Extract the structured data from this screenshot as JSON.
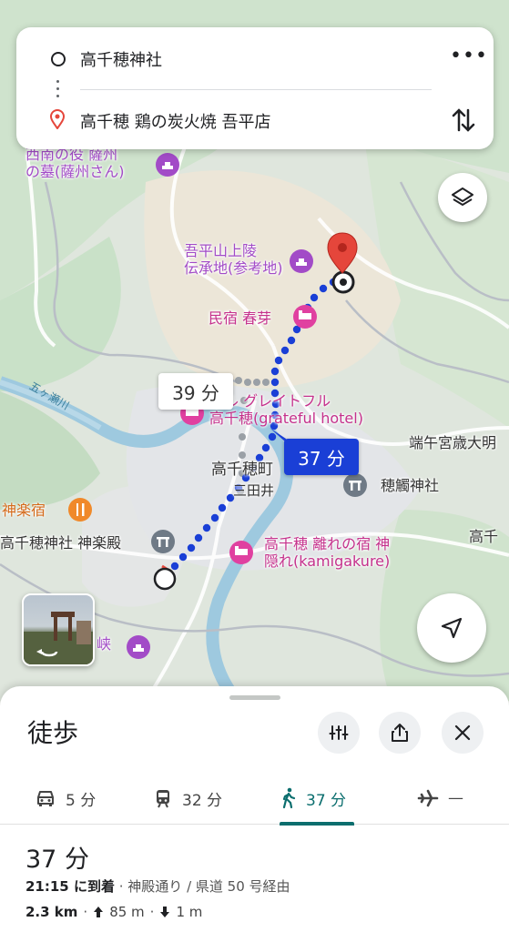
{
  "search": {
    "origin": "高千穂神社",
    "destination": "高千穂 鶏の炭火焼 吾平店"
  },
  "map": {
    "labels": {
      "satsuma_grave": "西南の役 薩州\nの墓(薩州さん)",
      "ahira_ryo": "吾平山上陵\n伝承地(参考地)",
      "minshuku": "民宿 春芽",
      "hotel": "テル グレイトフル\n高千穂(grateful hotel)",
      "gokase_river": "五ヶ瀬川",
      "town": "高千穂町",
      "mitai": "三田井",
      "kagura_inn": "神楽宿",
      "kagura_den": "高千穂神社 神楽殿",
      "kamigakure": "高千穂 離れの宿 神\n隠れ(kamigakure)",
      "hodai_shrine": "穂觸神社",
      "hashigo": "端午宮歳大明",
      "takachiho_right": "高千",
      "gorge": "峡"
    },
    "alt_route_time": "39 分",
    "route_time": "37 分"
  },
  "sheet": {
    "mode_title": "徒歩",
    "tabs": [
      {
        "label": "5 分",
        "icon": "car-icon"
      },
      {
        "label": "32 分",
        "icon": "train-icon"
      },
      {
        "label": "37 分",
        "icon": "walk-icon",
        "active": true
      },
      {
        "label": "—",
        "icon": "plane-icon"
      }
    ],
    "duration": "37 分",
    "arrival_time": "21:15 に到着",
    "via": "· 神殿通り / 県道 50 号経由",
    "distance": "2.3 km",
    "ascent": "85 m",
    "descent": "1 m",
    "sep": "·"
  },
  "colors": {
    "route_blue": "#1a3fd6",
    "active_tab": "#0b6e6e",
    "poi_purple": "#a24bc7",
    "pin_red": "#e5463b"
  }
}
